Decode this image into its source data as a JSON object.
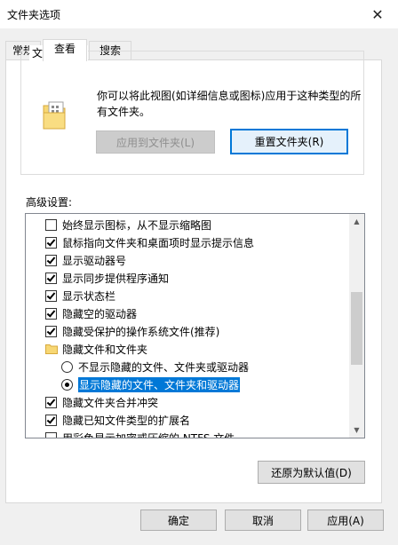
{
  "window": {
    "title": "文件夹选项",
    "close_glyph": "✕"
  },
  "tabs": [
    {
      "label": "常规"
    },
    {
      "label": "查看"
    },
    {
      "label": "搜索"
    }
  ],
  "folder_views": {
    "group_title": "文件夹视图",
    "description": "你可以将此视图(如详细信息或图标)应用于这种类型的所有文件夹。",
    "apply_button": "应用到文件夹(L)",
    "reset_button": "重置文件夹(R)"
  },
  "advanced": {
    "label": "高级设置:",
    "items": [
      {
        "type": "checkbox",
        "checked": false,
        "label": "始终显示图标，从不显示缩略图"
      },
      {
        "type": "checkbox",
        "checked": true,
        "label": "鼠标指向文件夹和桌面项时显示提示信息"
      },
      {
        "type": "checkbox",
        "checked": true,
        "label": "显示驱动器号"
      },
      {
        "type": "checkbox",
        "checked": true,
        "label": "显示同步提供程序通知"
      },
      {
        "type": "checkbox",
        "checked": true,
        "label": "显示状态栏"
      },
      {
        "type": "checkbox",
        "checked": true,
        "label": "隐藏空的驱动器"
      },
      {
        "type": "checkbox",
        "checked": true,
        "label": "隐藏受保护的操作系统文件(推荐)"
      },
      {
        "type": "folder",
        "label": "隐藏文件和文件夹"
      },
      {
        "type": "radio",
        "checked": false,
        "label": "不显示隐藏的文件、文件夹或驱动器"
      },
      {
        "type": "radio",
        "checked": true,
        "selected": true,
        "label": "显示隐藏的文件、文件夹和驱动器"
      },
      {
        "type": "checkbox",
        "checked": true,
        "label": "隐藏文件夹合并冲突"
      },
      {
        "type": "checkbox",
        "checked": true,
        "label": "隐藏已知文件类型的扩展名"
      },
      {
        "type": "checkbox",
        "checked": false,
        "label": "用彩色显示加密或压缩的 NTFS 文件"
      }
    ],
    "restore_button": "还原为默认值(D)"
  },
  "buttons": {
    "ok": "确定",
    "cancel": "取消",
    "apply": "应用(A)"
  },
  "colors": {
    "accent": "#0078d7",
    "dialog_bg": "#f0f0f0",
    "folder": "#f7d774"
  }
}
